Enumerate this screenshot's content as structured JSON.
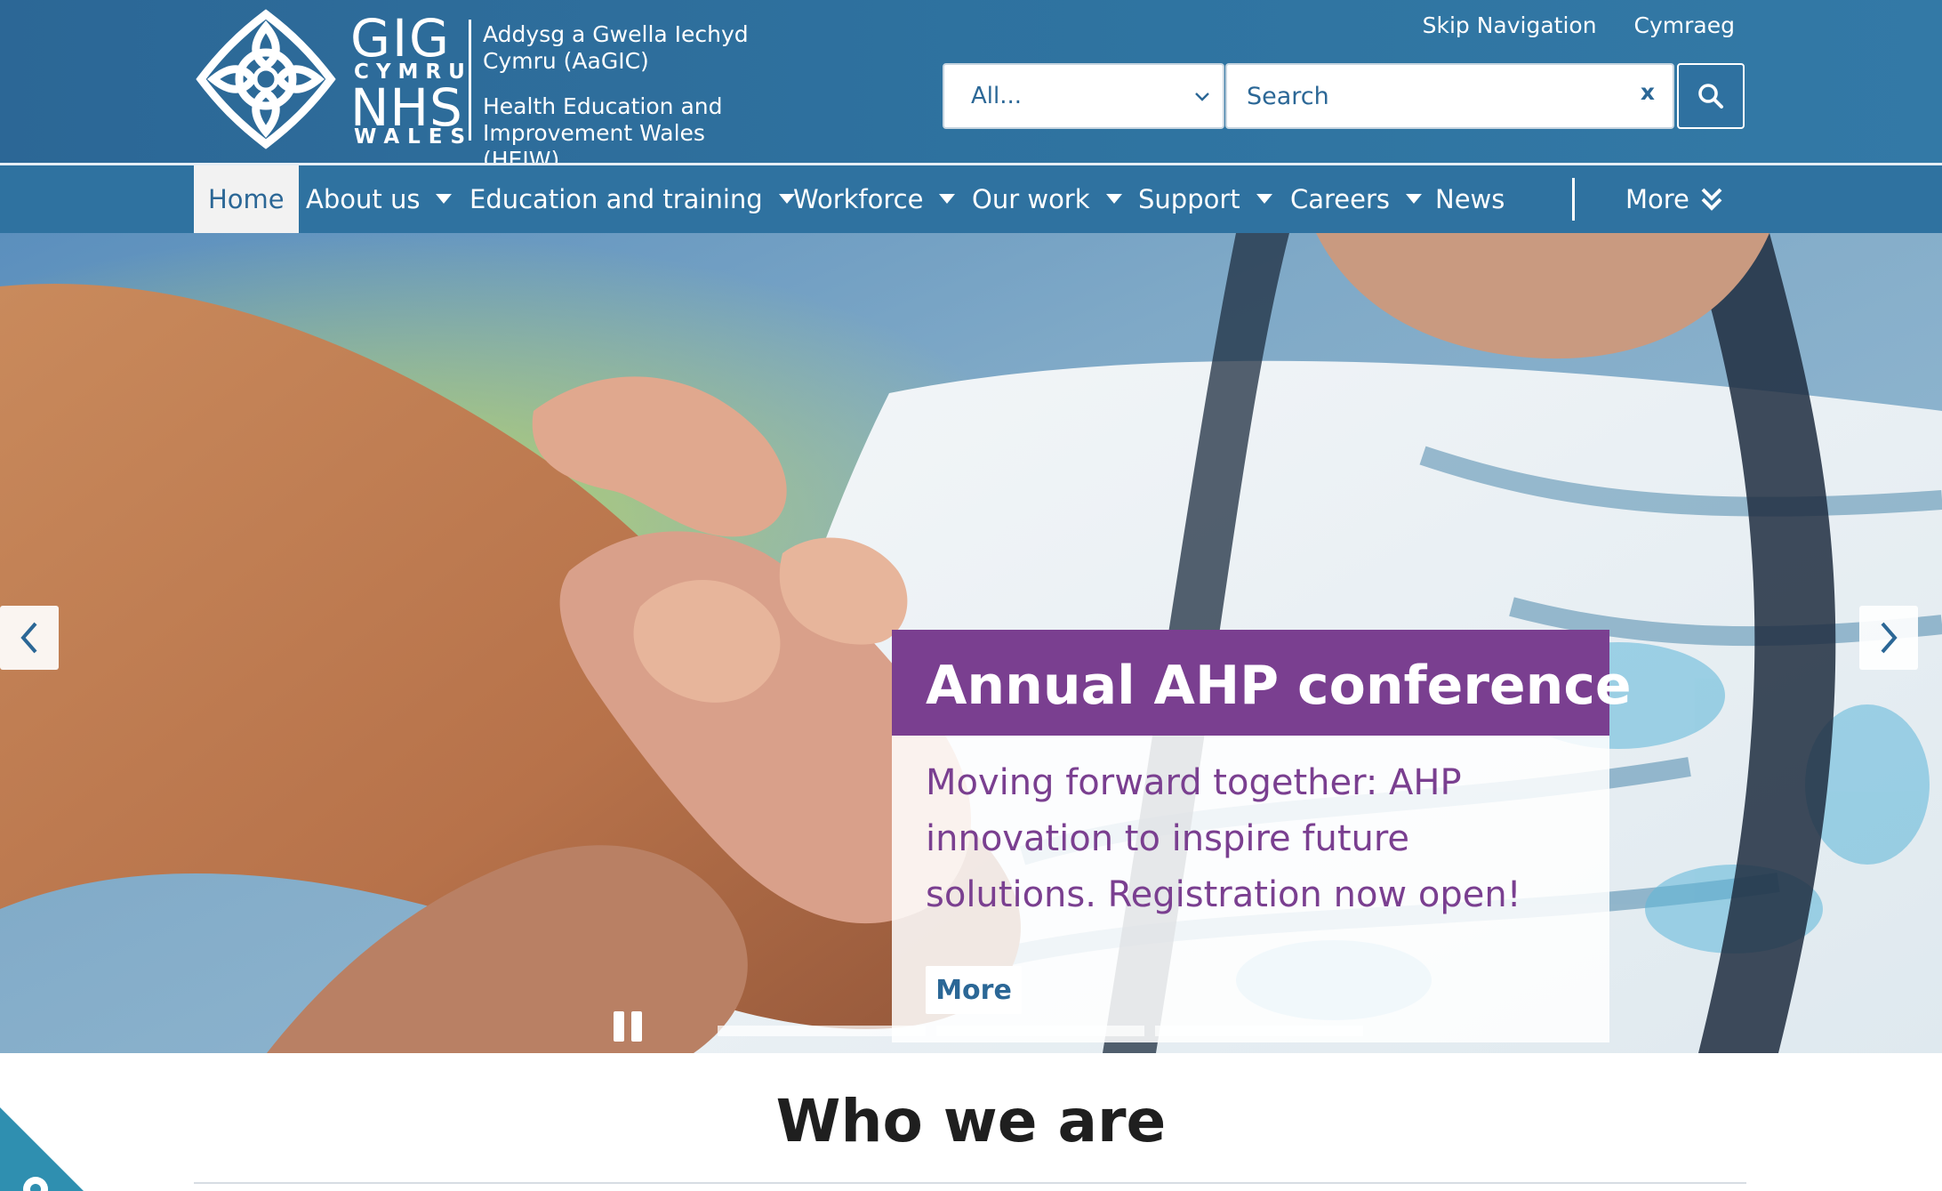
{
  "header": {
    "logo": {
      "gig": "GIG",
      "cymru": "CYMRU",
      "nhs": "NHS",
      "wales": "WALES",
      "org_cy": "Addysg a Gwella Iechyd Cymru (AaGIC)",
      "org_en": "Health Education and Improvement Wales (HEIW)"
    },
    "top_links": {
      "skip": "Skip Navigation",
      "language": "Cymraeg"
    },
    "search": {
      "scope_value": "All...",
      "placeholder": "Search",
      "clear_label": "x",
      "button_icon": "search-icon"
    }
  },
  "nav": {
    "items": [
      {
        "label": "Home",
        "active": true,
        "dropdown": false
      },
      {
        "label": "About us",
        "dropdown": true
      },
      {
        "label": "Education and training",
        "dropdown": true
      },
      {
        "label": "Workforce",
        "dropdown": true
      },
      {
        "label": "Our work",
        "dropdown": true
      },
      {
        "label": "Support",
        "dropdown": true
      },
      {
        "label": "Careers",
        "dropdown": true
      },
      {
        "label": "News",
        "dropdown": false
      }
    ],
    "more_label": "More"
  },
  "hero": {
    "slide": {
      "title": "Annual AHP conference",
      "text": "Moving forward together: AHP innovation to inspire future solutions. Registration now open!",
      "more_label": "More"
    },
    "slide_count": 3,
    "active_slide": 1
  },
  "section": {
    "title": "Who we are"
  },
  "colors": {
    "header_blue": "#2f72a0",
    "accent_purple": "#7a3f90",
    "link_blue": "#2b6796",
    "corner_teal": "#2f8fb0"
  }
}
